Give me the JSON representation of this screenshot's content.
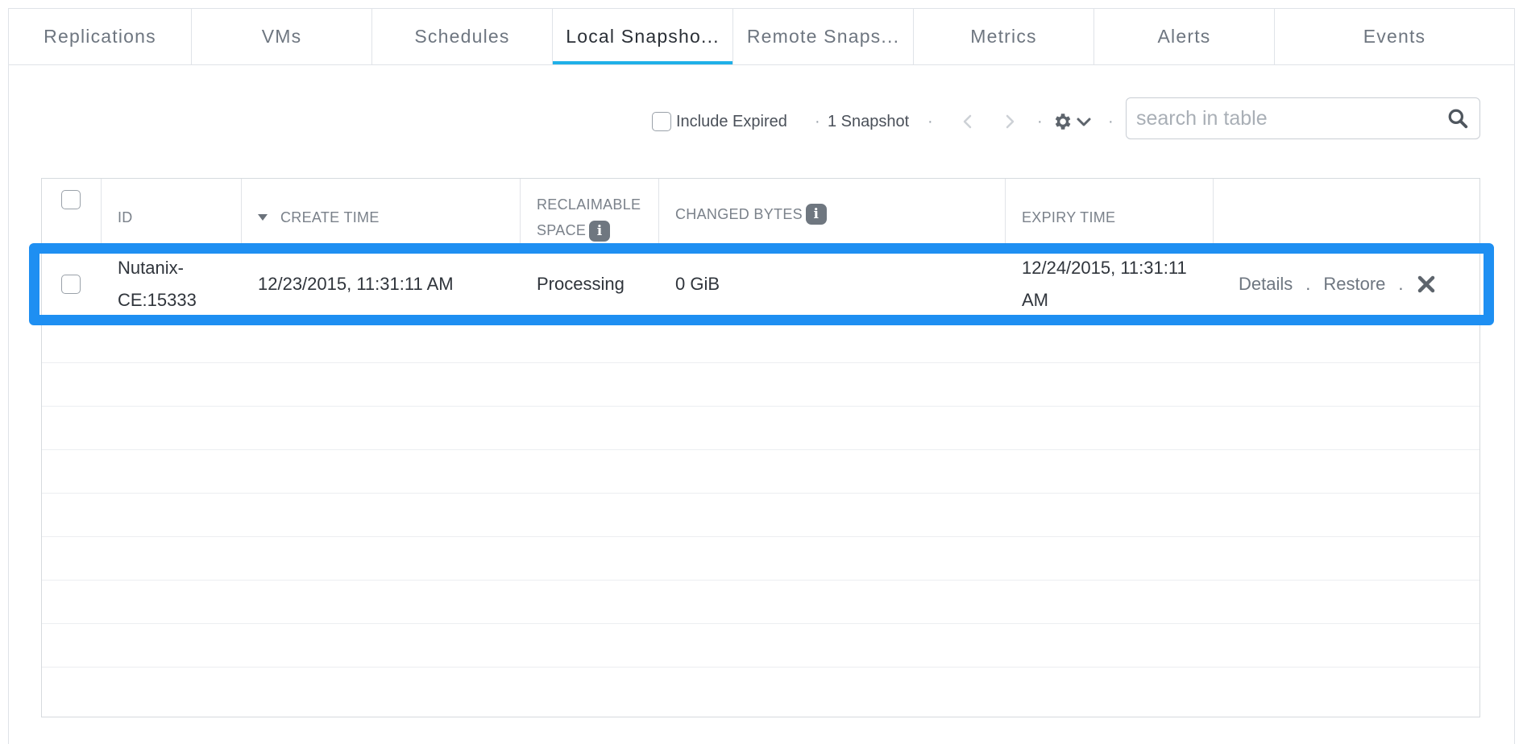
{
  "tabs": [
    {
      "label": "Replications",
      "active": false
    },
    {
      "label": "VMs",
      "active": false
    },
    {
      "label": "Schedules",
      "active": false
    },
    {
      "label": "Local Snapsho...",
      "active": true
    },
    {
      "label": "Remote Snaps...",
      "active": false
    },
    {
      "label": "Metrics",
      "active": false
    },
    {
      "label": "Alerts",
      "active": false
    },
    {
      "label": "Events",
      "active": false
    }
  ],
  "toolbar": {
    "include_expired_label": "Include Expired",
    "count_label": "1 Snapshot",
    "separator": "·",
    "search_placeholder": "search in table"
  },
  "table": {
    "columns": {
      "id": "ID",
      "create_time": "CREATE TIME",
      "reclaimable_line1": "RECLAIMABLE",
      "reclaimable_line2": "SPACE",
      "changed_bytes": "CHANGED BYTES",
      "expiry_time": "EXPIRY TIME"
    },
    "info_glyph": "i",
    "rows": [
      {
        "id_line1": "Nutanix-",
        "id_line2": "CE:15333",
        "create_time": "12/23/2015, 11:31:11 AM",
        "reclaimable_space": "Processing",
        "changed_bytes": "0 GiB",
        "expiry_line1": "12/24/2015, 11:31:11",
        "expiry_line2": "AM",
        "actions": {
          "details": "Details",
          "restore": "Restore",
          "separator": "."
        }
      }
    ]
  },
  "colors": {
    "active_tab_underline": "#1fb0e8",
    "row_highlight": "#1e8ff2"
  }
}
